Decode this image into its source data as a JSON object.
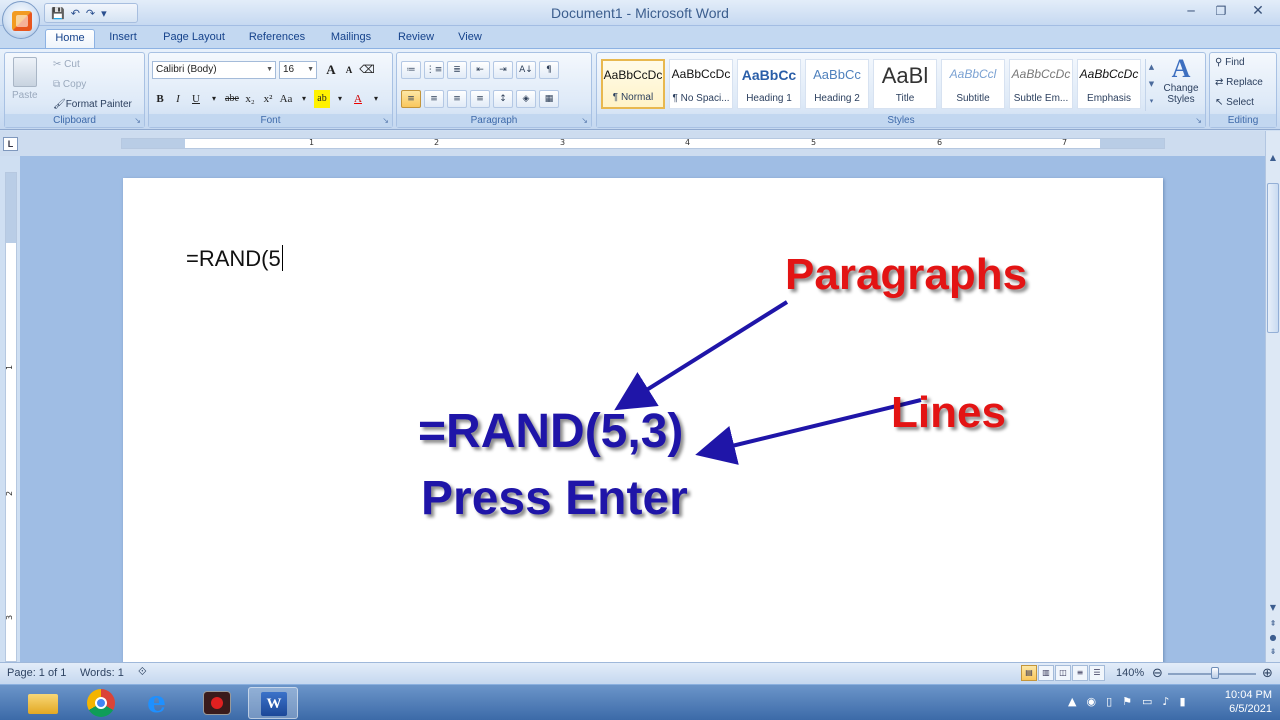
{
  "window": {
    "title": "Document1 - Microsoft Word",
    "minimize": "─",
    "restore": "❐",
    "close": "✕"
  },
  "qat": {
    "save": "💾",
    "undo": "↶",
    "redo": "↷",
    "more": "▾"
  },
  "tabs": [
    "Home",
    "Insert",
    "Page Layout",
    "References",
    "Mailings",
    "Review",
    "View"
  ],
  "clipboard": {
    "paste": "Paste",
    "cut": "Cut",
    "copy": "Copy",
    "format_painter": "Format Painter",
    "label": "Clipboard"
  },
  "font": {
    "name": "Calibri (Body)",
    "size": "16",
    "grow": "A",
    "shrink": "A",
    "buttons": [
      "B",
      "I",
      "U",
      "abe",
      "x₂",
      "x²",
      "Aa"
    ],
    "label": "Font"
  },
  "paragraph": {
    "label": "Paragraph",
    "row1": [
      "≔",
      "⋮≡",
      "≣",
      "⇤",
      "⇥",
      "A↓",
      "¶"
    ],
    "row2": [
      "≡",
      "≡",
      "≡",
      "≡",
      "↕",
      "◈",
      "▦"
    ]
  },
  "styles": {
    "label": "Styles",
    "items": [
      {
        "preview": "AaBbCcDc",
        "name": "¶ Normal"
      },
      {
        "preview": "AaBbCcDc",
        "name": "¶ No Spaci..."
      },
      {
        "preview": "AaBbCc",
        "name": "Heading 1"
      },
      {
        "preview": "AaBbCc",
        "name": "Heading 2"
      },
      {
        "preview": "AaBl",
        "name": "Title"
      },
      {
        "preview": "AaBbCcl",
        "name": "Subtitle"
      },
      {
        "preview": "AaBbCcDc",
        "name": "Subtle Em..."
      },
      {
        "preview": "AaBbCcDc",
        "name": "Emphasis"
      }
    ],
    "change_styles_1": "Change",
    "change_styles_2": "Styles"
  },
  "editing": {
    "label": "Editing",
    "find": "Find",
    "replace": "Replace",
    "select": "Select"
  },
  "ruler": {
    "corner": "L",
    "numbers": [
      "1",
      "2",
      "3",
      "4",
      "5",
      "6",
      "7"
    ],
    "vnumbers": [
      "1",
      "2",
      "3"
    ]
  },
  "document": {
    "typed_text": "=RAND(5",
    "annotation_paragraphs": "Paragraphs",
    "annotation_formula": "=RAND(5,3)",
    "annotation_press": "Press Enter",
    "annotation_lines": "Lines",
    "colors": {
      "red": "#e31414",
      "blue": "#1f15a8"
    }
  },
  "status": {
    "page": "Page: 1 of 1",
    "words": "Words: 1",
    "zoom": "140%",
    "zoom_minus": "⊖",
    "zoom_plus": "⊕"
  },
  "taskbar": {
    "time": "10:04 PM",
    "date": "6/5/2021",
    "apps": [
      "file-explorer-icon",
      "chrome-icon",
      "internet-explorer-icon",
      "screen-recorder-icon",
      "word-icon"
    ]
  }
}
